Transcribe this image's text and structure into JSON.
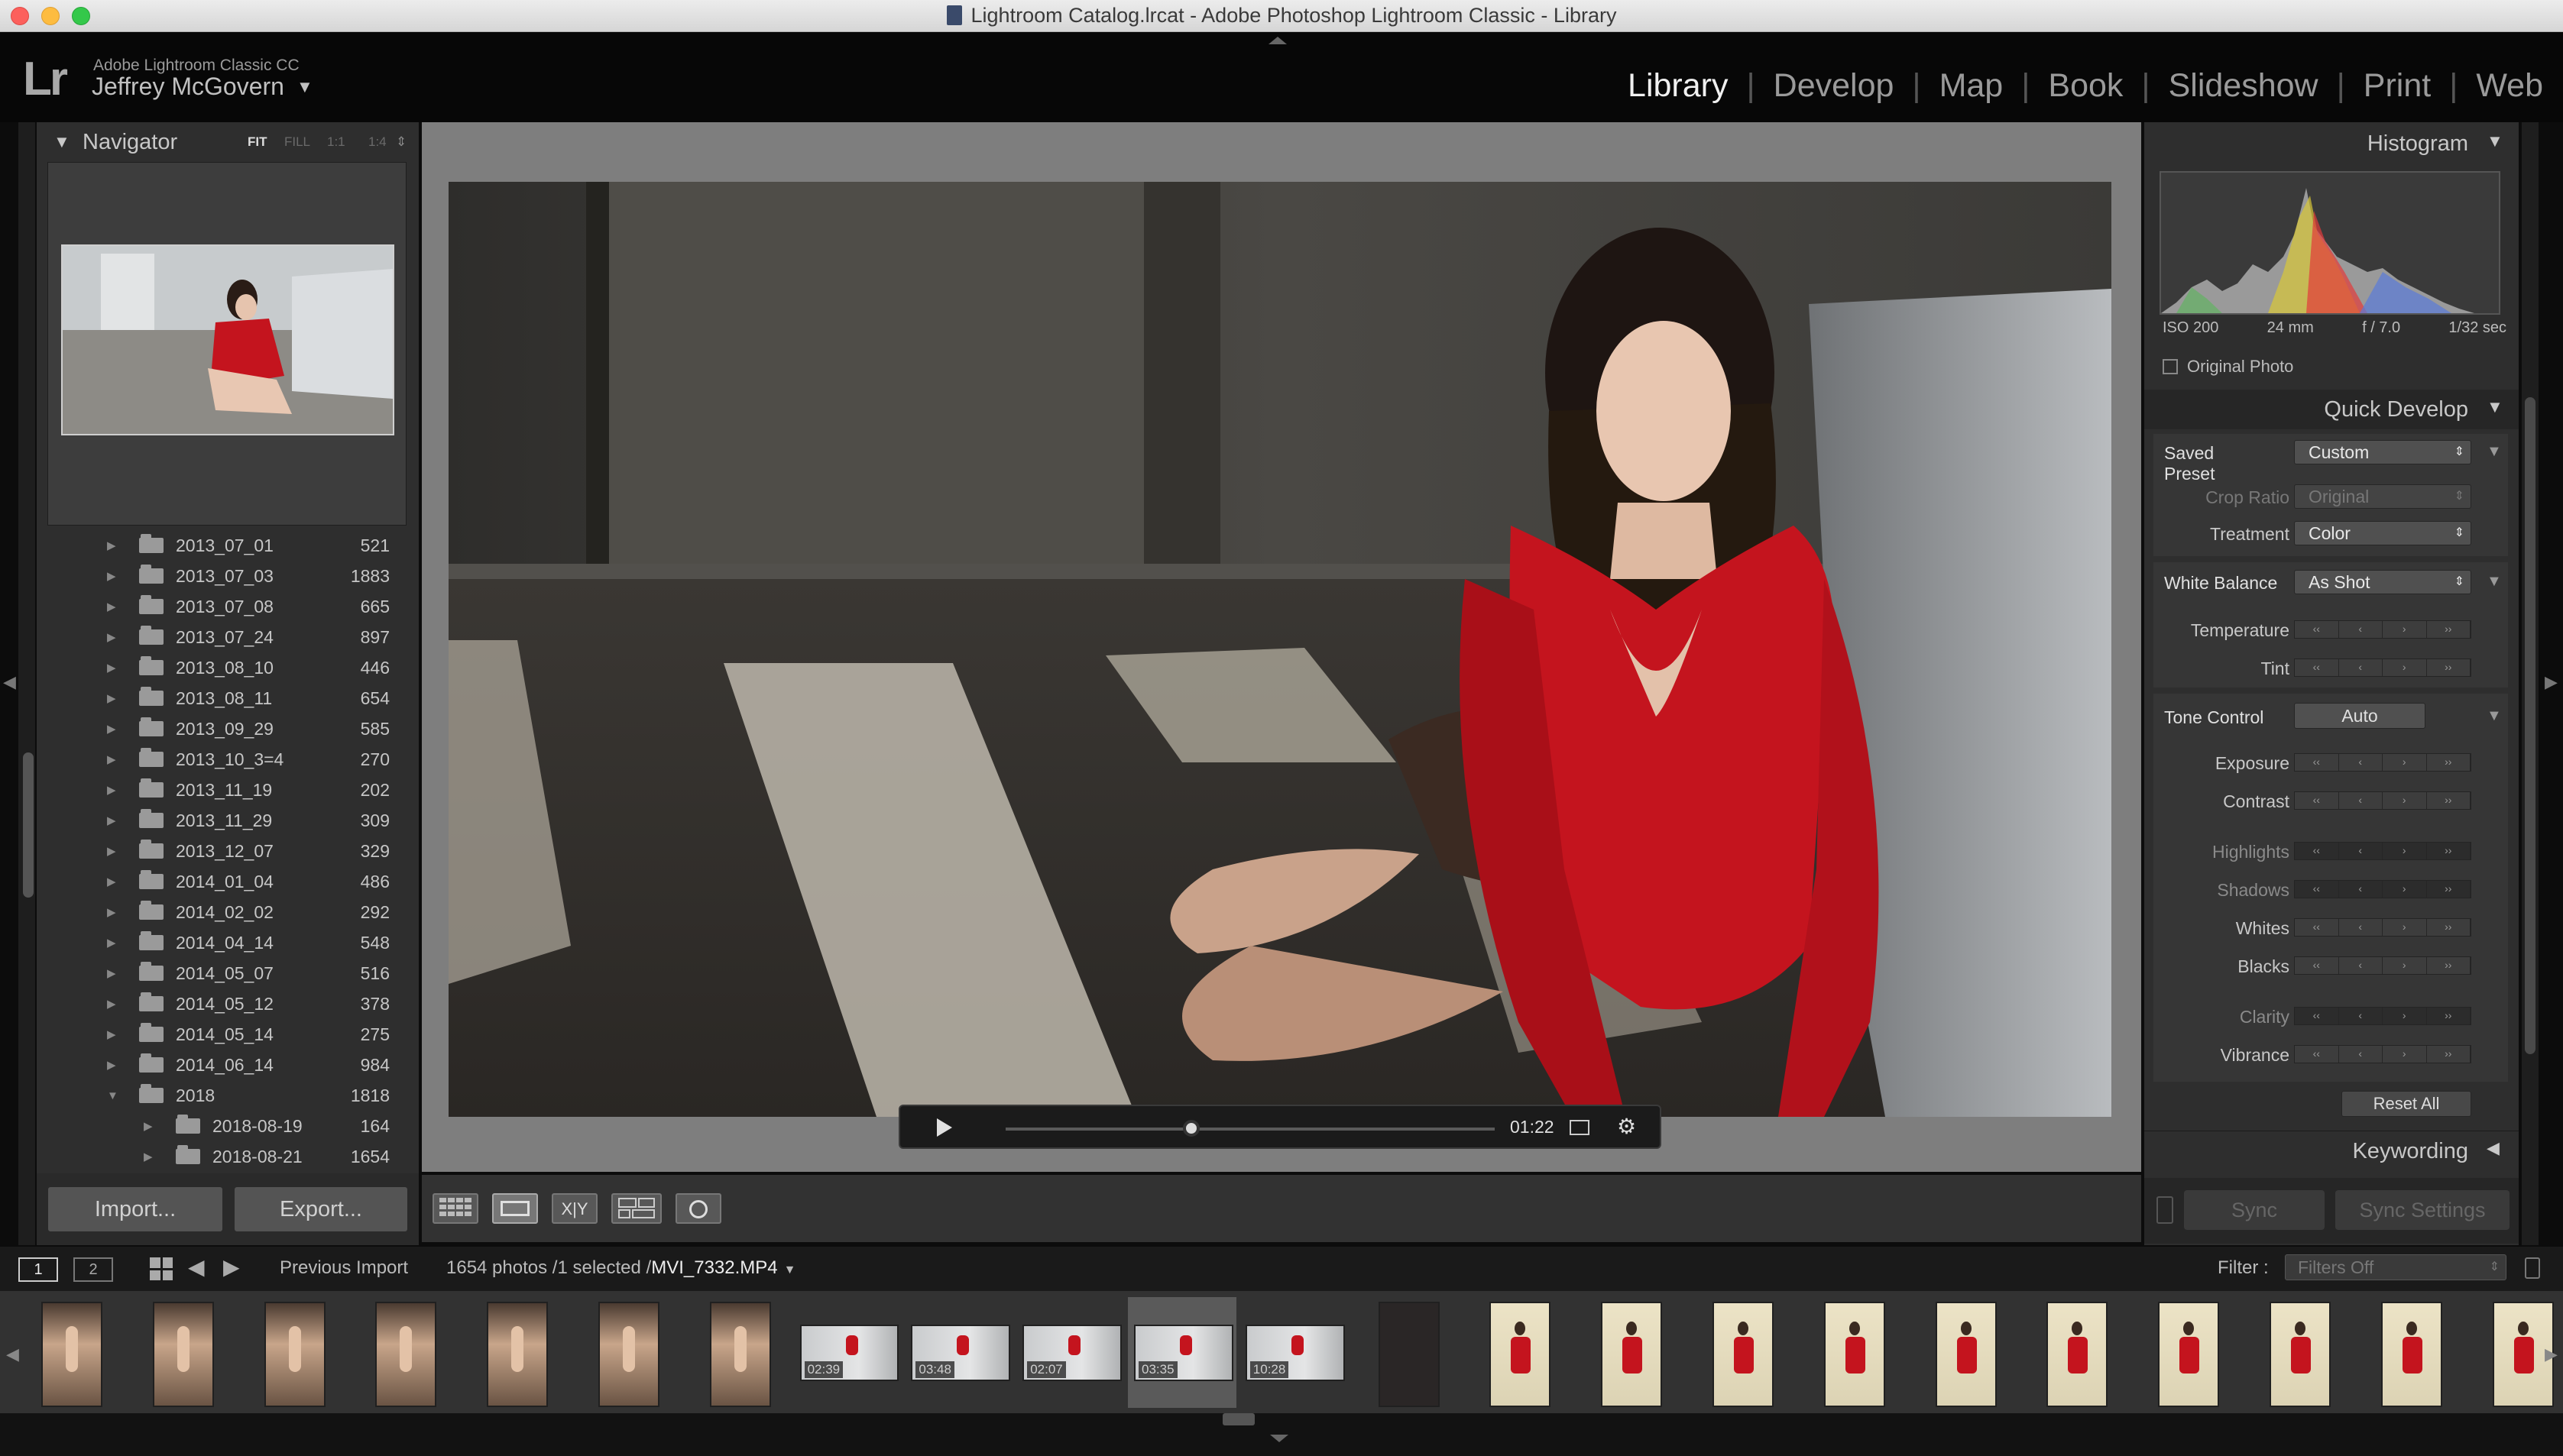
{
  "window": {
    "title": "Lightroom Catalog.lrcat - Adobe Photoshop Lightroom Classic - Library"
  },
  "identity": {
    "logo": "Lr",
    "app_name": "Adobe Lightroom Classic CC",
    "user": "Jeffrey McGovern",
    "user_menu_icon": "triangle-down-icon"
  },
  "modules": [
    {
      "label": "Library",
      "active": true
    },
    {
      "label": "Develop"
    },
    {
      "label": "Map"
    },
    {
      "label": "Book"
    },
    {
      "label": "Slideshow"
    },
    {
      "label": "Print"
    },
    {
      "label": "Web"
    }
  ],
  "navigator": {
    "title": "Navigator",
    "zoom_options": [
      "FIT",
      "FILL",
      "1:1",
      "1:4"
    ]
  },
  "folders": [
    {
      "name": "2013_07_01",
      "count": "521"
    },
    {
      "name": "2013_07_03",
      "count": "1883"
    },
    {
      "name": "2013_07_08",
      "count": "665"
    },
    {
      "name": "2013_07_24",
      "count": "897"
    },
    {
      "name": "2013_08_10",
      "count": "446"
    },
    {
      "name": "2013_08_11",
      "count": "654"
    },
    {
      "name": "2013_09_29",
      "count": "585"
    },
    {
      "name": "2013_10_3=4",
      "count": "270"
    },
    {
      "name": "2013_11_19",
      "count": "202"
    },
    {
      "name": "2013_11_29",
      "count": "309"
    },
    {
      "name": "2013_12_07",
      "count": "329"
    },
    {
      "name": "2014_01_04",
      "count": "486"
    },
    {
      "name": "2014_02_02",
      "count": "292"
    },
    {
      "name": "2014_04_14",
      "count": "548"
    },
    {
      "name": "2014_05_07",
      "count": "516"
    },
    {
      "name": "2014_05_12",
      "count": "378"
    },
    {
      "name": "2014_05_14",
      "count": "275"
    },
    {
      "name": "2014_06_14",
      "count": "984"
    },
    {
      "name": "2018",
      "count": "1818",
      "expanded": true
    },
    {
      "name": "2018-08-19",
      "count": "164",
      "child": true
    },
    {
      "name": "2018-08-21",
      "count": "1654",
      "child": true
    }
  ],
  "left_buttons": {
    "import": "Import...",
    "export": "Export..."
  },
  "video": {
    "time": "01:22",
    "progress": 0.38
  },
  "toolbar_tools": [
    "grid-view-icon",
    "loupe-view-icon",
    "compare-view-icon",
    "survey-view-icon",
    "people-view-icon"
  ],
  "compare_label": "X|Y",
  "histogram": {
    "title": "Histogram",
    "iso": "ISO 200",
    "focal": "24 mm",
    "aperture": "f / 7.0",
    "shutter": "1/32 sec",
    "original_photo": "Original Photo"
  },
  "quick_develop": {
    "title": "Quick Develop",
    "saved_preset_label": "Saved Preset",
    "saved_preset": "Custom",
    "crop_ratio_label": "Crop Ratio",
    "crop_ratio": "Original",
    "treatment_label": "Treatment",
    "treatment": "Color",
    "white_balance_label": "White Balance",
    "white_balance": "As Shot",
    "temperature": "Temperature",
    "tint": "Tint",
    "tone_control": "Tone Control",
    "auto": "Auto",
    "exposure": "Exposure",
    "contrast": "Contrast",
    "highlights": "Highlights",
    "shadows": "Shadows",
    "whites": "Whites",
    "blacks": "Blacks",
    "clarity": "Clarity",
    "vibrance": "Vibrance",
    "reset_all": "Reset All"
  },
  "keywording": {
    "title": "Keywording"
  },
  "sync": {
    "sync": "Sync",
    "sync_settings": "Sync Settings"
  },
  "filmbar": {
    "monitor1": "1",
    "monitor2": "2",
    "source": "Previous Import",
    "info": "1654 photos /1 selected /",
    "filename": "MVI_7332.MP4",
    "filter_label": "Filter :",
    "filter_value": "Filters Off"
  },
  "filmstrip_timestamps": [
    "02:39",
    "03:48",
    "02:07",
    "03:35",
    "10:28"
  ],
  "colors": {
    "accent": "#f0f0f0",
    "panel": "#2e2e2e",
    "main_bg": "#7e7e7e",
    "red": "#c4141e"
  }
}
